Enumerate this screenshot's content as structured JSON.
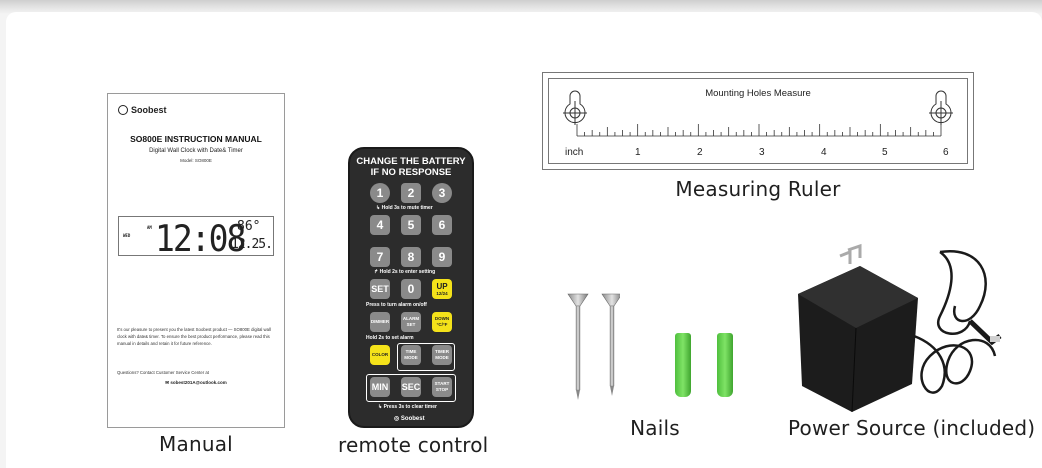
{
  "captions": {
    "manual": "Manual",
    "remote": "remote control",
    "ruler": "Measuring Ruler",
    "nails": "Nails",
    "power": "Power Source (included)"
  },
  "manual": {
    "brand": "Soobest",
    "title": "SO800E INSTRUCTION MANUAL",
    "subtitle": "Digital Wall Clock with Date& Timer",
    "model": "Model: SO800E",
    "lcd_day": "WED",
    "lcd_am": "AM",
    "lcd_time": "12:08",
    "lcd_temp": "86°",
    "lcd_date": "12.25.",
    "paragraph": "It's our pleasure to present you the latest Soobest product — SO800E digital wall clock with date& timer. To ensure the best product performance, please read this manual in details and retain it for future reference.",
    "contact": "Questions? Contact Customer Service Center at",
    "email": "sobest201A@outlook.com"
  },
  "remote": {
    "heading_line1": "CHANGE THE BATTERY",
    "heading_line2": "IF NO RESPONSE",
    "note_mute": "Hold 3s to mute timer",
    "note_setting": "Hold 2s to enter setting",
    "note_alarm_toggle": "Press to turn alarm on/off",
    "note_set_alarm": "Hold 2s to set alarm",
    "note_clear": "Press 3s to clear timer",
    "brand": "Soobest",
    "buttons": {
      "b1": "1",
      "b2": "2",
      "b3": "3",
      "b4": "4",
      "b5": "5",
      "b6": "6",
      "b7": "7",
      "b8": "8",
      "b9": "9",
      "set": "SET",
      "b0": "0",
      "up": "UP",
      "up_sub": "12/24",
      "dimmer": "DIMMER",
      "alarm_set": "ALARM SET",
      "down": "DOWN",
      "down_sub": "°C/°F",
      "color": "COLOR",
      "time_mode": "TIME MODE",
      "timer_mode": "TIMER MODE",
      "min": "MIN",
      "sec": "SEC",
      "start_stop": "START STOP"
    }
  },
  "ruler": {
    "title": "Mounting  Holes  Measure",
    "unit": "inch",
    "numbers": [
      "1",
      "2",
      "3",
      "4",
      "5",
      "6"
    ]
  },
  "colors": {
    "remote_body": "#2c2c2c",
    "remote_button": "#8a8a8a",
    "remote_highlight": "#f4e21a",
    "anchor_green": "#5fcf47",
    "adapter_black": "#1c1c1c"
  }
}
